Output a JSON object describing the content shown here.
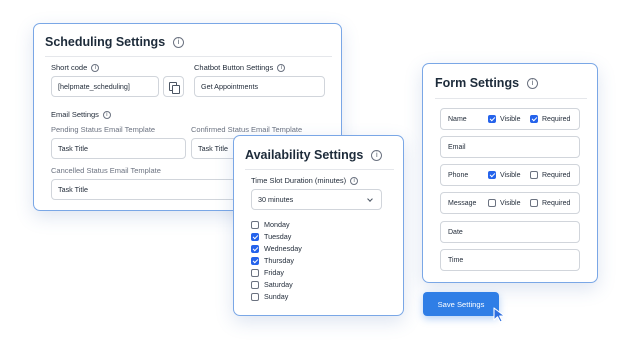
{
  "scheduling": {
    "title": "Scheduling Settings",
    "short_code_label": "Short code",
    "short_code_value": "[helpmate_scheduling]",
    "chatbot_label": "Chatbot Button Settings",
    "chatbot_value": "Get Appointments",
    "email_settings_label": "Email Settings",
    "pending_label": "Pending Status Email Template",
    "pending_value": "Task Title",
    "confirmed_label": "Confirmed Status Email Template",
    "confirmed_value": "Task Title",
    "cancelled_label": "Cancelled Status Email Template",
    "cancelled_value": "Task Title"
  },
  "availability": {
    "title": "Availability Settings",
    "duration_label": "Time Slot Duration (minutes)",
    "duration_value": "30 minutes",
    "days": [
      {
        "label": "Monday",
        "checked": false
      },
      {
        "label": "Tuesday",
        "checked": true
      },
      {
        "label": "Wednesday",
        "checked": true
      },
      {
        "label": "Thursday",
        "checked": true
      },
      {
        "label": "Friday",
        "checked": false
      },
      {
        "label": "Saturday",
        "checked": false
      },
      {
        "label": "Sunday",
        "checked": false
      }
    ]
  },
  "form": {
    "title": "Form Settings",
    "visible_label": "Visible",
    "required_label": "Required",
    "fields": [
      {
        "label": "Name",
        "visible": true,
        "required": true,
        "has_options": true
      },
      {
        "label": "Email",
        "has_options": false
      },
      {
        "label": "Phone",
        "visible": true,
        "required": false,
        "has_options": true
      },
      {
        "label": "Message",
        "visible": false,
        "required": false,
        "has_options": true
      },
      {
        "label": "Date",
        "has_options": false
      },
      {
        "label": "Time",
        "has_options": false
      }
    ]
  },
  "save_button_label": "Save Settings",
  "icons": {
    "info": "info-icon",
    "copy": "copy-icon",
    "dropdown": "chevron-down-icon",
    "cursor": "cursor-icon"
  },
  "colors": {
    "accent": "#2563eb",
    "button": "#2f7ee6",
    "card_border": "#7aa7e6"
  }
}
